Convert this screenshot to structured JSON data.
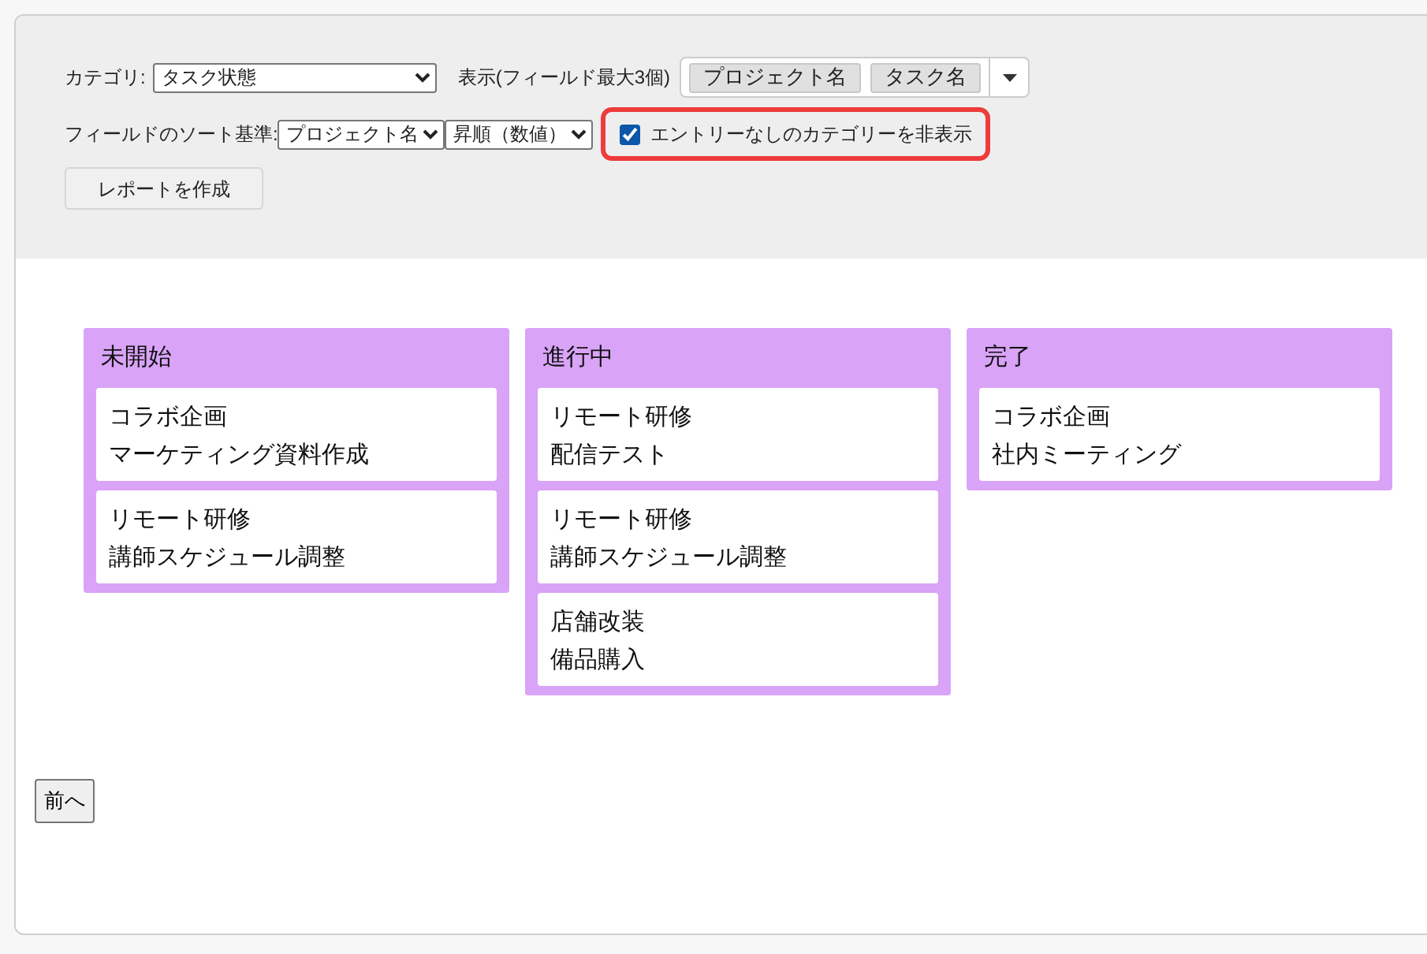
{
  "filters": {
    "category_label": "カテゴリ:",
    "category_value": "タスク状態",
    "display_label": "表示(フィールド最大3個)",
    "display_fields": [
      "プロジェクト名",
      "タスク名"
    ],
    "sort_label": "フィールドのソート基準:",
    "sort_field": "プロジェクト名",
    "sort_order": "昇順（数値）",
    "hide_empty": {
      "label": "エントリーなしのカテゴリーを非表示",
      "checked": true,
      "highlighted": true
    },
    "create_button": "レポートを作成"
  },
  "columns": [
    {
      "title": "未開始",
      "cards": [
        {
          "lines": [
            "コラボ企画",
            "マーケティング資料作成"
          ]
        },
        {
          "lines": [
            "リモート研修",
            "講師スケジュール調整"
          ]
        }
      ]
    },
    {
      "title": "進行中",
      "cards": [
        {
          "lines": [
            "リモート研修",
            "配信テスト"
          ]
        },
        {
          "lines": [
            "リモート研修",
            "講師スケジュール調整"
          ]
        },
        {
          "lines": [
            "店舗改装",
            "備品購入"
          ]
        }
      ]
    },
    {
      "title": "完了",
      "cards": [
        {
          "lines": [
            "コラボ企画",
            "社内ミーティング"
          ]
        }
      ]
    }
  ],
  "prev_button": "前へ"
}
